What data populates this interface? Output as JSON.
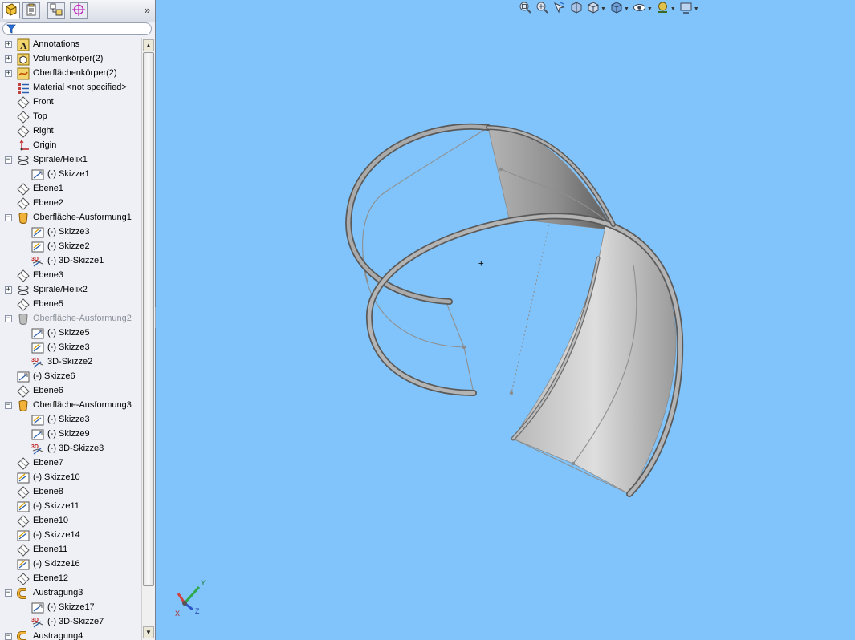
{
  "panel": {
    "tabs": [
      {
        "name": "featuremanager-tab-icon",
        "active": true
      },
      {
        "name": "propertymanager-tab-icon",
        "active": false
      },
      {
        "name": "configurationmanager-tab-icon",
        "active": false
      },
      {
        "name": "dimxpert-tab-icon",
        "active": false
      }
    ],
    "expand_label": "»"
  },
  "tree": [
    {
      "label": "Annotations",
      "icon": "annotations",
      "level": 0,
      "exp": "+"
    },
    {
      "label": "Volumenkörper(2)",
      "icon": "solid",
      "level": 0,
      "exp": "+"
    },
    {
      "label": "Oberflächenkörper(2)",
      "icon": "surface",
      "level": 0,
      "exp": "+"
    },
    {
      "label": "Material <not specified>",
      "icon": "material",
      "level": 0,
      "exp": ""
    },
    {
      "label": "Front",
      "icon": "plane",
      "level": 0,
      "exp": ""
    },
    {
      "label": "Top",
      "icon": "plane",
      "level": 0,
      "exp": ""
    },
    {
      "label": "Right",
      "icon": "plane",
      "level": 0,
      "exp": ""
    },
    {
      "label": "Origin",
      "icon": "origin",
      "level": 0,
      "exp": ""
    },
    {
      "label": "Spirale/Helix1",
      "icon": "helix",
      "level": 0,
      "exp": "-"
    },
    {
      "label": "(-) Skizze1",
      "icon": "sketch",
      "level": 1,
      "exp": ""
    },
    {
      "label": "Ebene1",
      "icon": "plane",
      "level": 0,
      "exp": ""
    },
    {
      "label": "Ebene2",
      "icon": "plane",
      "level": 0,
      "exp": ""
    },
    {
      "label": "Oberfläche-Ausformung1",
      "icon": "loft",
      "level": 0,
      "exp": "-"
    },
    {
      "label": "(-) Skizze3",
      "icon": "sketch-used",
      "level": 1,
      "exp": ""
    },
    {
      "label": "(-) Skizze2",
      "icon": "sketch-used",
      "level": 1,
      "exp": ""
    },
    {
      "label": "(-) 3D-Skizze1",
      "icon": "sketch3d",
      "level": 1,
      "exp": ""
    },
    {
      "label": "Ebene3",
      "icon": "plane",
      "level": 0,
      "exp": ""
    },
    {
      "label": "Spirale/Helix2",
      "icon": "helix",
      "level": 0,
      "exp": "+"
    },
    {
      "label": "Ebene5",
      "icon": "plane",
      "level": 0,
      "exp": ""
    },
    {
      "label": "Oberfläche-Ausformung2",
      "icon": "loft-dim",
      "level": 0,
      "exp": "-",
      "dim": true
    },
    {
      "label": "(-) Skizze5",
      "icon": "sketch",
      "level": 1,
      "exp": ""
    },
    {
      "label": "(-) Skizze3",
      "icon": "sketch-used",
      "level": 1,
      "exp": ""
    },
    {
      "label": "3D-Skizze2",
      "icon": "sketch3d",
      "level": 1,
      "exp": ""
    },
    {
      "label": "(-) Skizze6",
      "icon": "sketch",
      "level": 0,
      "exp": ""
    },
    {
      "label": "Ebene6",
      "icon": "plane",
      "level": 0,
      "exp": ""
    },
    {
      "label": "Oberfläche-Ausformung3",
      "icon": "loft",
      "level": 0,
      "exp": "-"
    },
    {
      "label": "(-) Skizze3",
      "icon": "sketch-used",
      "level": 1,
      "exp": ""
    },
    {
      "label": "(-) Skizze9",
      "icon": "sketch",
      "level": 1,
      "exp": ""
    },
    {
      "label": "(-) 3D-Skizze3",
      "icon": "sketch3d",
      "level": 1,
      "exp": ""
    },
    {
      "label": "Ebene7",
      "icon": "plane",
      "level": 0,
      "exp": ""
    },
    {
      "label": "(-) Skizze10",
      "icon": "sketch-used",
      "level": 0,
      "exp": ""
    },
    {
      "label": "Ebene8",
      "icon": "plane",
      "level": 0,
      "exp": ""
    },
    {
      "label": "(-) Skizze11",
      "icon": "sketch-used",
      "level": 0,
      "exp": ""
    },
    {
      "label": "Ebene10",
      "icon": "plane",
      "level": 0,
      "exp": ""
    },
    {
      "label": "(-) Skizze14",
      "icon": "sketch-used",
      "level": 0,
      "exp": ""
    },
    {
      "label": "Ebene11",
      "icon": "plane",
      "level": 0,
      "exp": ""
    },
    {
      "label": "(-) Skizze16",
      "icon": "sketch-used",
      "level": 0,
      "exp": ""
    },
    {
      "label": "Ebene12",
      "icon": "plane",
      "level": 0,
      "exp": ""
    },
    {
      "label": "Austragung3",
      "icon": "sweep",
      "level": 0,
      "exp": "-"
    },
    {
      "label": "(-) Skizze17",
      "icon": "sketch",
      "level": 1,
      "exp": ""
    },
    {
      "label": "(-) 3D-Skizze7",
      "icon": "sketch3d",
      "level": 1,
      "exp": ""
    },
    {
      "label": "Austragung4",
      "icon": "sweep",
      "level": 0,
      "exp": "-"
    }
  ],
  "hud": [
    {
      "name": "zoom-to-fit-icon",
      "dropdown": false
    },
    {
      "name": "zoom-to-area-icon",
      "dropdown": false
    },
    {
      "name": "previous-view-icon",
      "dropdown": false
    },
    {
      "name": "section-view-icon",
      "dropdown": false
    },
    {
      "name": "view-orientation-icon",
      "dropdown": true
    },
    {
      "name": "display-style-icon",
      "dropdown": true
    },
    {
      "name": "hide-show-items-icon",
      "dropdown": true
    },
    {
      "name": "edit-appearance-icon",
      "dropdown": true
    },
    {
      "name": "apply-scene-icon",
      "dropdown": true
    }
  ],
  "triad": {
    "x_label": "X",
    "y_label": "Y",
    "z_label": "Z"
  },
  "colors": {
    "viewport_bg": "#80c4fb",
    "surface": "#c8c8c8",
    "tube": "#9a9a9a"
  }
}
